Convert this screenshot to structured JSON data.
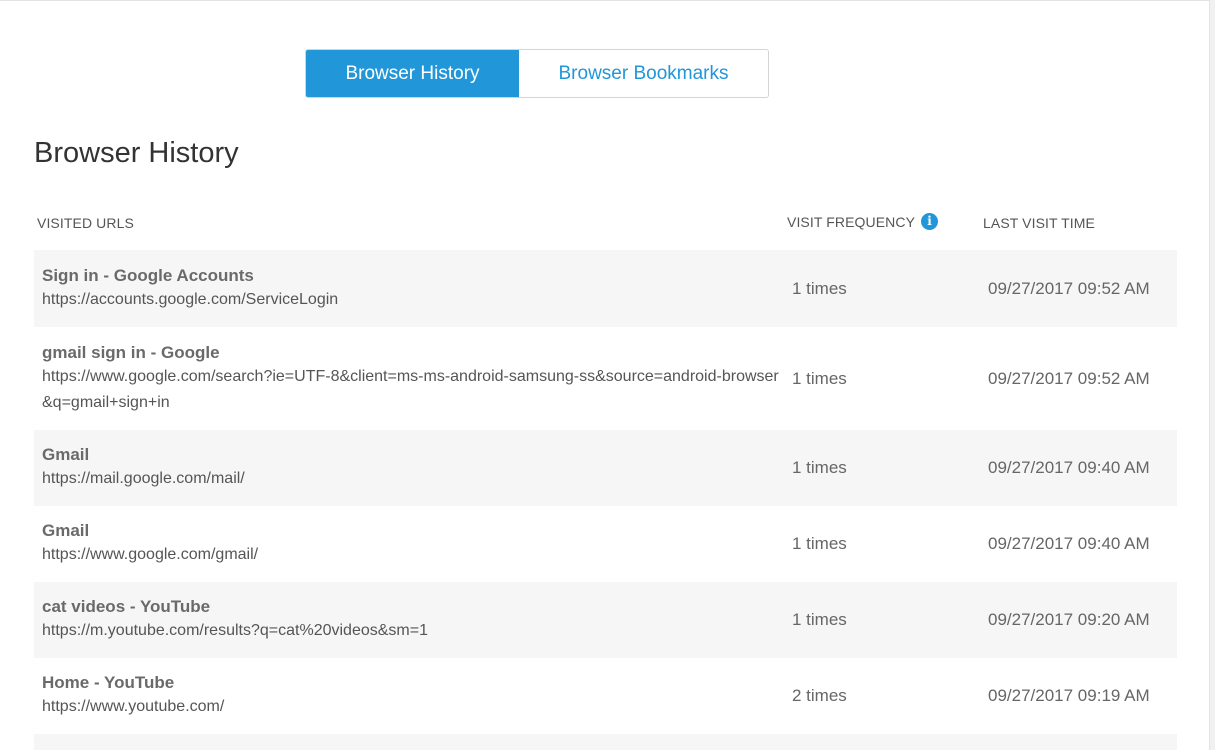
{
  "tabs": [
    {
      "label": "Browser History",
      "active": true
    },
    {
      "label": "Browser Bookmarks",
      "active": false
    }
  ],
  "page_title": "Browser History",
  "columns": {
    "urls": "VISITED URLS",
    "frequency": "VISIT FREQUENCY",
    "last_visit": "LAST VISIT TIME"
  },
  "info_icon": "info-icon",
  "colors": {
    "accent": "#2196d9",
    "row_shade": "#f6f6f6"
  },
  "rows": [
    {
      "title": "Sign in - Google Accounts",
      "url": "https://accounts.google.com/ServiceLogin",
      "frequency": "1 times",
      "time": "09/27/2017 09:52 AM"
    },
    {
      "title": "gmail sign in - Google",
      "url": "https://www.google.com/search?ie=UTF-8&client=ms-ms-android-samsung-ss&source=android-browser&q=gmail+sign+in",
      "frequency": "1 times",
      "time": "09/27/2017 09:52 AM"
    },
    {
      "title": "Gmail",
      "url": "https://mail.google.com/mail/",
      "frequency": "1 times",
      "time": "09/27/2017 09:40 AM"
    },
    {
      "title": "Gmail",
      "url": "https://www.google.com/gmail/",
      "frequency": "1 times",
      "time": "09/27/2017 09:40 AM"
    },
    {
      "title": "cat videos - YouTube",
      "url": "https://m.youtube.com/results?q=cat%20videos&sm=1",
      "frequency": "1 times",
      "time": "09/27/2017 09:20 AM"
    },
    {
      "title": "Home - YouTube",
      "url": "https://www.youtube.com/",
      "frequency": "2 times",
      "time": "09/27/2017 09:19 AM"
    }
  ]
}
